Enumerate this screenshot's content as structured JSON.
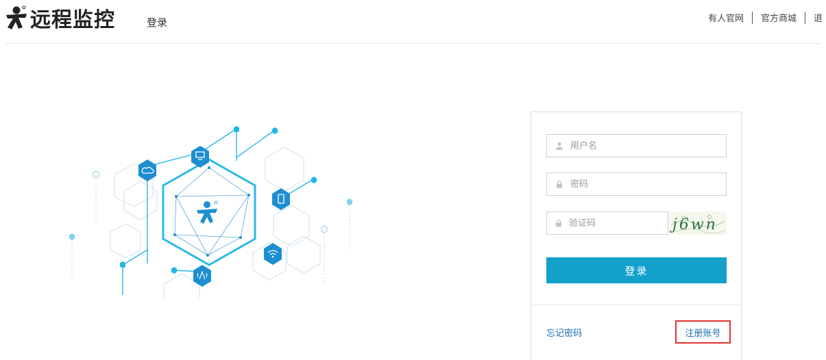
{
  "header": {
    "logo_text": "远程监控",
    "page_title": "登录",
    "nav": [
      {
        "label": "有人官网"
      },
      {
        "label": "官方商城"
      },
      {
        "label": "退"
      }
    ]
  },
  "illustration": {
    "icons": [
      "cloud-icon",
      "computer-icon",
      "mobile-icon",
      "wifi-icon",
      "antenna-icon",
      "mascot-icon"
    ]
  },
  "login": {
    "username_placeholder": "用户名",
    "password_placeholder": "密码",
    "captcha_placeholder": "验证码",
    "captcha_text": "j6wn",
    "submit_label": "登录",
    "forgot_label": "忘记密码",
    "register_label": "注册账号"
  },
  "colors": {
    "accent": "#13a0cb",
    "link": "#1a6fb0",
    "highlight": "#e0322f",
    "hex_blue": "#1d8fd0"
  }
}
